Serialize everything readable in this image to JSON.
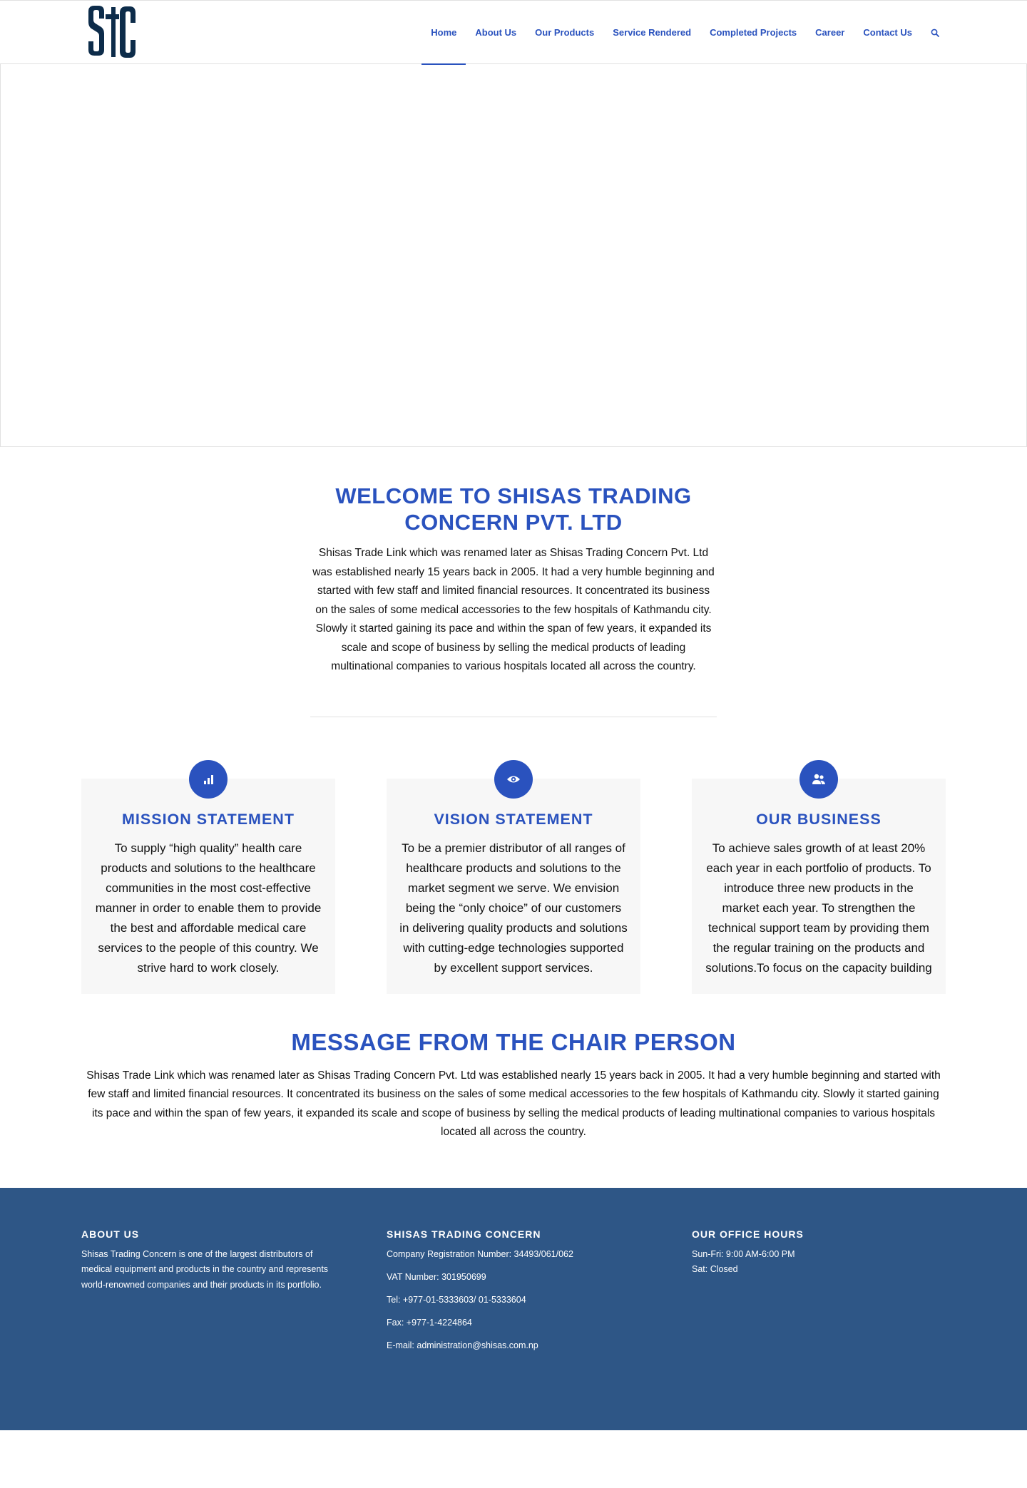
{
  "logo": {
    "text": "STC",
    "color": "#0d2c4a"
  },
  "nav": {
    "items": [
      {
        "label": "Home",
        "active": true
      },
      {
        "label": "About Us"
      },
      {
        "label": "Our Products"
      },
      {
        "label": "Service Rendered"
      },
      {
        "label": "Completed Projects"
      },
      {
        "label": "Career"
      },
      {
        "label": "Contact Us"
      }
    ],
    "search_icon": "search-icon"
  },
  "welcome": {
    "title": "WELCOME TO SHISAS TRADING CONCERN PVT. LTD",
    "text": "Shisas Trade  Link which was renamed later as Shisas Trading Concern Pvt. Ltd was established nearly  15 years back in  2005. It had a  very humble beginning and started with few staff and limited financial resources.  It concentrated its business on the sales of some medical accessories to the few hospitals of Kathmandu city.  Slowly  it started  gaining  its pace and within the span of few years,  it expanded its scale  and scope  of business  by selling  the  medical  products  of leading multinational companies to various hospitals  located all across the country."
  },
  "features": [
    {
      "icon": "bar-chart-icon",
      "title": "MISSION STATEMENT",
      "text": "To supply “high quality” health care products and solutions to the healthcare communities in the most cost-effective manner in order to enable them to provide the best and affordable medical care services to the people of this country.   We strive hard to work closely."
    },
    {
      "icon": "eye-icon",
      "title": "VISION STATEMENT",
      "text": "To be a premier distributor of all ranges of healthcare products and solutions to the market segment we serve. We envision being the “only choice”   of our customers in delivering quality products and solutions with cutting-edge technologies supported by excellent support services."
    },
    {
      "icon": "users-icon",
      "title": "OUR BUSINESS",
      "text": "To achieve sales growth of at least 20% each year in each portfolio of products.  To introduce three new products in the market each year. To strengthen the technical support team by providing them the regular training on the products and solutions.To focus on the capacity building"
    }
  ],
  "chair": {
    "title": "MESSAGE FROM THE CHAIR PERSON",
    "text": "Shisas Trade  Link which was renamed later as Shisas Trading Concern Pvt. Ltd was established nearly  15 years back in  2005. It had a  very humble beginning and started with few staff and limited financial resources.  It concentrated its business on the sales of some medical accessories to the few hospitals of Kathmandu city.  Slowly  it started  gaining  its pace and within the span of few years,  it expanded its scale  and scope  of business  by selling  the  medical  products  of leading multinational companies to various hospitals  located all across the country."
  },
  "footer": {
    "about": {
      "heading": "ABOUT US",
      "text": "Shisas Trading Concern is one of the largest distributors of medical equipment and products in the country and represents world-renowned companies and their products in its portfolio."
    },
    "company": {
      "heading": "SHISAS TRADING CONCERN",
      "lines": [
        "Company Registration Number: 34493/061/062",
        "VAT Number: 301950699",
        "Tel:   +977-01-5333603/ 01-5333604",
        "Fax:   +977-1-4224864",
        "E-mail:  administration@shisas.com.np"
      ]
    },
    "hours": {
      "heading": "OUR OFFICE HOURS",
      "lines": [
        "Sun-Fri: 9:00 AM-6:00 PM",
        "Sat: Closed"
      ]
    }
  },
  "colors": {
    "accent": "#2a52be",
    "footer_bg": "#2e5686",
    "feature_bg": "#f7f7f7"
  }
}
